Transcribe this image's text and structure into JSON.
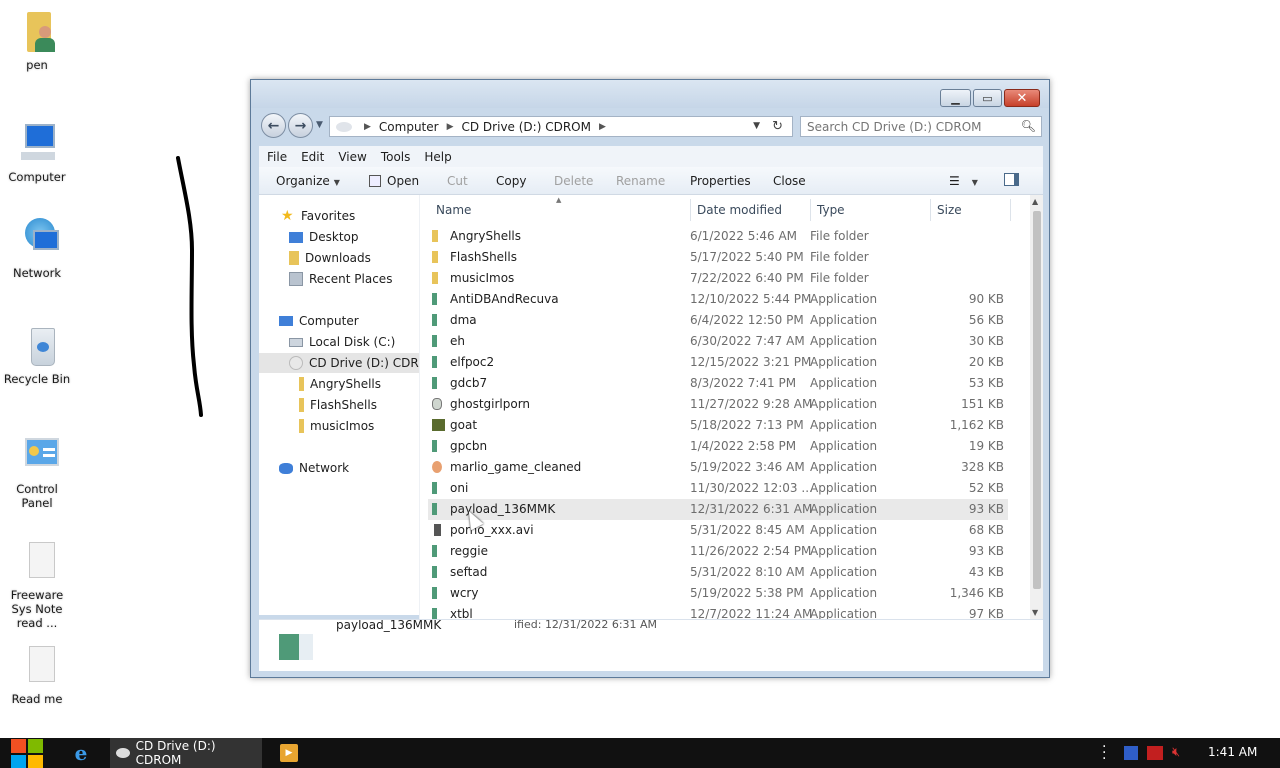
{
  "desktop": {
    "icons": [
      {
        "label": "pen"
      },
      {
        "label": "Computer"
      },
      {
        "label": "Network"
      },
      {
        "label": "Recycle Bin"
      },
      {
        "label": "Control Panel"
      },
      {
        "label": "Freeware Sys Note read ..."
      },
      {
        "label": "Read me"
      }
    ]
  },
  "window": {
    "address": {
      "crumbs": [
        "Computer",
        "CD Drive (D:) CDROM"
      ]
    },
    "search": {
      "placeholder": "Search CD Drive (D:) CDROM"
    },
    "menu": [
      "File",
      "Edit",
      "View",
      "Tools",
      "Help"
    ],
    "commands": {
      "organize": "Organize",
      "open": "Open",
      "cut": "Cut",
      "copy": "Copy",
      "delete": "Delete",
      "rename": "Rename",
      "properties": "Properties",
      "close": "Close"
    },
    "nav": {
      "favorites": "Favorites",
      "desktop": "Desktop",
      "downloads": "Downloads",
      "recent": "Recent Places",
      "computer": "Computer",
      "local_disk": "Local Disk (C:)",
      "cd_drive": "CD Drive (D:) CDROM",
      "angry": "AngryShells",
      "flash": "FlashShells",
      "music": "musicImos",
      "network": "Network"
    },
    "columns": {
      "name": "Name",
      "date": "Date modified",
      "type": "Type",
      "size": "Size"
    },
    "files": [
      {
        "name": "AngryShells",
        "date": "6/1/2022 5:46 AM",
        "type": "File folder",
        "size": "",
        "icon": "folder"
      },
      {
        "name": "FlashShells",
        "date": "5/17/2022 5:40 PM",
        "type": "File folder",
        "size": "",
        "icon": "folder"
      },
      {
        "name": "musicImos",
        "date": "7/22/2022 6:40 PM",
        "type": "File folder",
        "size": "",
        "icon": "folder"
      },
      {
        "name": "AntiDBAndRecuva",
        "date": "12/10/2022 5:44 PM",
        "type": "Application",
        "size": "90 KB",
        "icon": "app"
      },
      {
        "name": "dma",
        "date": "6/4/2022 12:50 PM",
        "type": "Application",
        "size": "56 KB",
        "icon": "app"
      },
      {
        "name": "eh",
        "date": "6/30/2022 7:47 AM",
        "type": "Application",
        "size": "30 KB",
        "icon": "app"
      },
      {
        "name": "elfpoc2",
        "date": "12/15/2022 3:21 PM",
        "type": "Application",
        "size": "20 KB",
        "icon": "app"
      },
      {
        "name": "gdcb7",
        "date": "8/3/2022 7:41 PM",
        "type": "Application",
        "size": "53 KB",
        "icon": "app"
      },
      {
        "name": "ghostgirlporn",
        "date": "11/27/2022 9:28 AM",
        "type": "Application",
        "size": "151 KB",
        "icon": "ghost"
      },
      {
        "name": "goat",
        "date": "5/18/2022 7:13 PM",
        "type": "Application",
        "size": "1,162 KB",
        "icon": "goat"
      },
      {
        "name": "gpcbn",
        "date": "1/4/2022 2:58 PM",
        "type": "Application",
        "size": "19 KB",
        "icon": "app"
      },
      {
        "name": "marlio_game_cleaned",
        "date": "5/19/2022 3:46 AM",
        "type": "Application",
        "size": "328 KB",
        "icon": "egg"
      },
      {
        "name": "oni",
        "date": "11/30/2022 12:03 ...",
        "type": "Application",
        "size": "52 KB",
        "icon": "app"
      },
      {
        "name": "payload_136MMK",
        "date": "12/31/2022 6:31 AM",
        "type": "Application",
        "size": "93 KB",
        "icon": "app"
      },
      {
        "name": "porno_xxx.avi",
        "date": "5/31/2022 8:45 AM",
        "type": "Application",
        "size": "68 KB",
        "icon": "porno"
      },
      {
        "name": "reggie",
        "date": "11/26/2022 2:54 PM",
        "type": "Application",
        "size": "93 KB",
        "icon": "app"
      },
      {
        "name": "seftad",
        "date": "5/31/2022 8:10 AM",
        "type": "Application",
        "size": "43 KB",
        "icon": "app"
      },
      {
        "name": "wcry",
        "date": "5/19/2022 5:38 PM",
        "type": "Application",
        "size": "1,346 KB",
        "icon": "app"
      },
      {
        "name": "xtbl",
        "date": "12/7/2022 11:24 AM",
        "type": "Application",
        "size": "97 KB",
        "icon": "app"
      }
    ],
    "details": {
      "name": "payload_136MMK",
      "modified": "ified: 12/31/2022 6:31 AM"
    }
  },
  "taskbar": {
    "task_label": "CD Drive (D:) CDROM",
    "clock": "1:41 AM"
  },
  "colors": {
    "app_icon": "#4f9a78",
    "folder_icon": "#e8c45a",
    "taskbar_bg": "#111111"
  }
}
